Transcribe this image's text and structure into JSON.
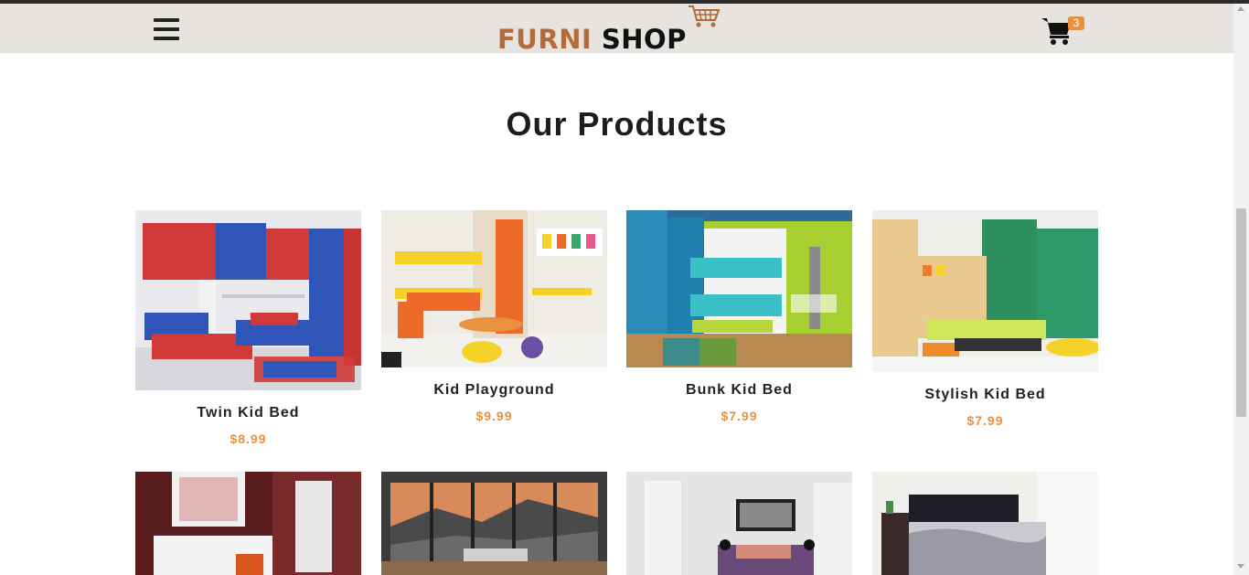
{
  "header": {
    "logo_part1": "FURNI",
    "logo_part2": "SHOP",
    "cart_count": "3",
    "menu_icon": "hamburger-menu-icon",
    "cart_icon": "shopping-cart-icon",
    "accent_color": "#e8913f",
    "brand_color": "#b36b39"
  },
  "section": {
    "title": "Our Products"
  },
  "products": [
    {
      "name": "Twin Kid Bed",
      "price": "$8.99"
    },
    {
      "name": "Kid Playground",
      "price": "$9.99"
    },
    {
      "name": "Bunk Kid Bed",
      "price": "$7.99"
    },
    {
      "name": "Stylish Kid Bed",
      "price": "$7.99"
    }
  ]
}
